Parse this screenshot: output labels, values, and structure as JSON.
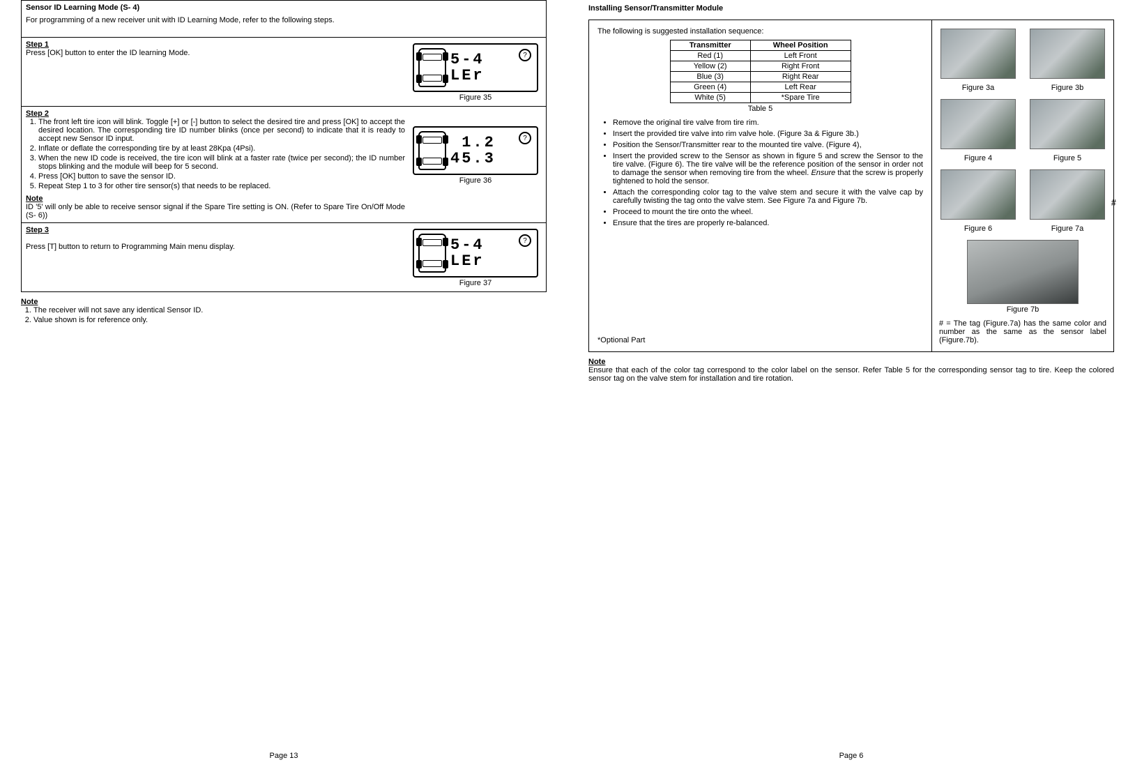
{
  "left_page": {
    "mode_title": "Sensor ID Learning Mode (S- 4)",
    "intro": "For programming of a new receiver unit with ID Learning Mode, refer to the following steps.",
    "step1_header": "Step 1",
    "step1_text": "Press [OK] button to enter the ID learning Mode.",
    "fig35": "Figure 35",
    "lcd35_line1": "5-4",
    "lcd35_line2": "LEr",
    "step2_header": "Step 2",
    "step2_items": [
      "The front left tire icon will blink. Toggle [+] or [-] button to select the desired tire and press [OK] to accept the desired location. The corresponding tire ID number blinks (once per second) to indicate that it is ready to accept new Sensor ID input.",
      "Inflate or deflate the corresponding tire by at least 28Kpa (4Psi).",
      "When the new ID code is received, the tire icon will blink at a faster rate (twice per second); the ID number stops blinking and the module will beep for 5 second.",
      "Press [OK] button to save the sensor ID.",
      "Repeat Step 1 to 3 for other tire sensor(s) that needs to be replaced."
    ],
    "fig36": "Figure 36",
    "lcd36_line1": " 1.2",
    "lcd36_line2": "45.3",
    "step2_note_header": "Note",
    "step2_note_text": "ID '5' will only be able to receive sensor signal if the Spare Tire setting is ON. (Refer to Spare Tire On/Off Mode (S- 6))",
    "step3_header": "Step 3",
    "step3_text": "Press [T] button to return to Programming Main menu display.",
    "fig37": "Figure 37",
    "lcd37_line1": "5-4",
    "lcd37_line2": "LEr",
    "bottom_note_header": "Note",
    "bottom_note_items": [
      "The receiver will not save any identical Sensor ID.",
      "Value shown is for reference only."
    ],
    "page_number": "Page 13"
  },
  "right_page": {
    "title": "Installing Sensor/Transmitter Module",
    "intro": "The following is suggested installation sequence:",
    "th_transmitter": "Transmitter",
    "th_position": "Wheel Position",
    "rows": [
      {
        "t": "Red (1)",
        "p": "Left Front"
      },
      {
        "t": "Yellow (2)",
        "p": "Right Front"
      },
      {
        "t": "Blue (3)",
        "p": "Right Rear"
      },
      {
        "t": "Green (4)",
        "p": "Left Rear"
      },
      {
        "t": "White (5)",
        "p": "*Spare Tire"
      }
    ],
    "table_caption": "Table 5",
    "bullets": [
      "Remove the original tire valve from tire rim.",
      "Insert the provided tire valve into rim valve hole. (Figure 3a & Figure 3b.)",
      "Position the Sensor/Transmitter rear to the mounted tire valve. (Figure 4),",
      "Insert the provided screw to the Sensor as shown in figure 5 and screw the Sensor to the tire valve. (Figure 6). The tire valve will be the reference position of the sensor in order not to damage the sensor when removing tire from the wheel. ",
      "Attach the corresponding color tag to the valve stem and secure it with the valve cap by carefully twisting the tag onto the valve stem. See Figure 7a and Figure 7b.",
      "Proceed to mount the tire onto the wheel.",
      "Ensure that the tires are properly re-balanced."
    ],
    "bullet4_ensure": "Ensure",
    "bullet4_rest": " that the screw is properly tightened to hold the sensor.",
    "optional": "*Optional Part",
    "fig3a": "Figure 3a",
    "fig3b": "Figure 3b",
    "fig4": "Figure 4",
    "fig5": "Figure 5",
    "fig6": "Figure 6",
    "fig7a": "Figure 7a",
    "fig7b": "Figure 7b",
    "hash_symbol": "#",
    "hash_note": "# = The tag (Figure.7a) has the same color and number as the same as the sensor label (Figure.7b).",
    "note_header": "Note",
    "note_text": "Ensure that each of the color tag correspond to the color label on the sensor. Refer Table 5 for the corresponding sensor tag to tire. Keep the colored sensor tag on the valve stem for installation and tire rotation.",
    "page_number": "Page 6"
  }
}
